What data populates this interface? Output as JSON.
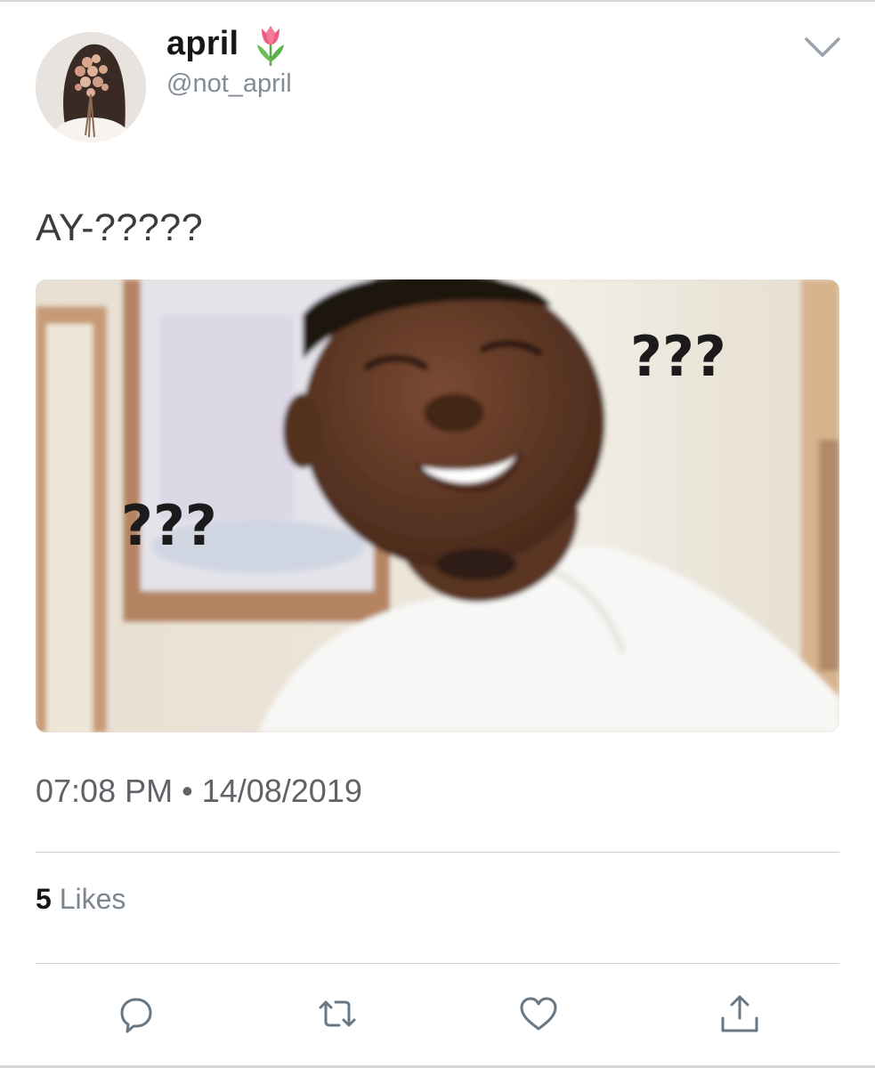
{
  "tweet": {
    "display_name": "april",
    "handle": "@not_april",
    "text": "AY-?????",
    "timestamp": "07:08 PM • 14/08/2019",
    "likes_count": "5",
    "likes_label": "Likes",
    "media_text": {
      "left_overlay": "???",
      "right_overlay": "???"
    }
  },
  "icons": {
    "badge": "tulip-icon",
    "menu": "chevron-down-icon",
    "reply": "reply-bubble-icon",
    "retweet": "retweet-icon",
    "like": "heart-icon",
    "share": "share-upload-icon"
  },
  "colors": {
    "text_primary": "#14171a",
    "text_secondary": "#828c95",
    "icon_gray": "#687782",
    "divider": "#cfd3d6"
  }
}
